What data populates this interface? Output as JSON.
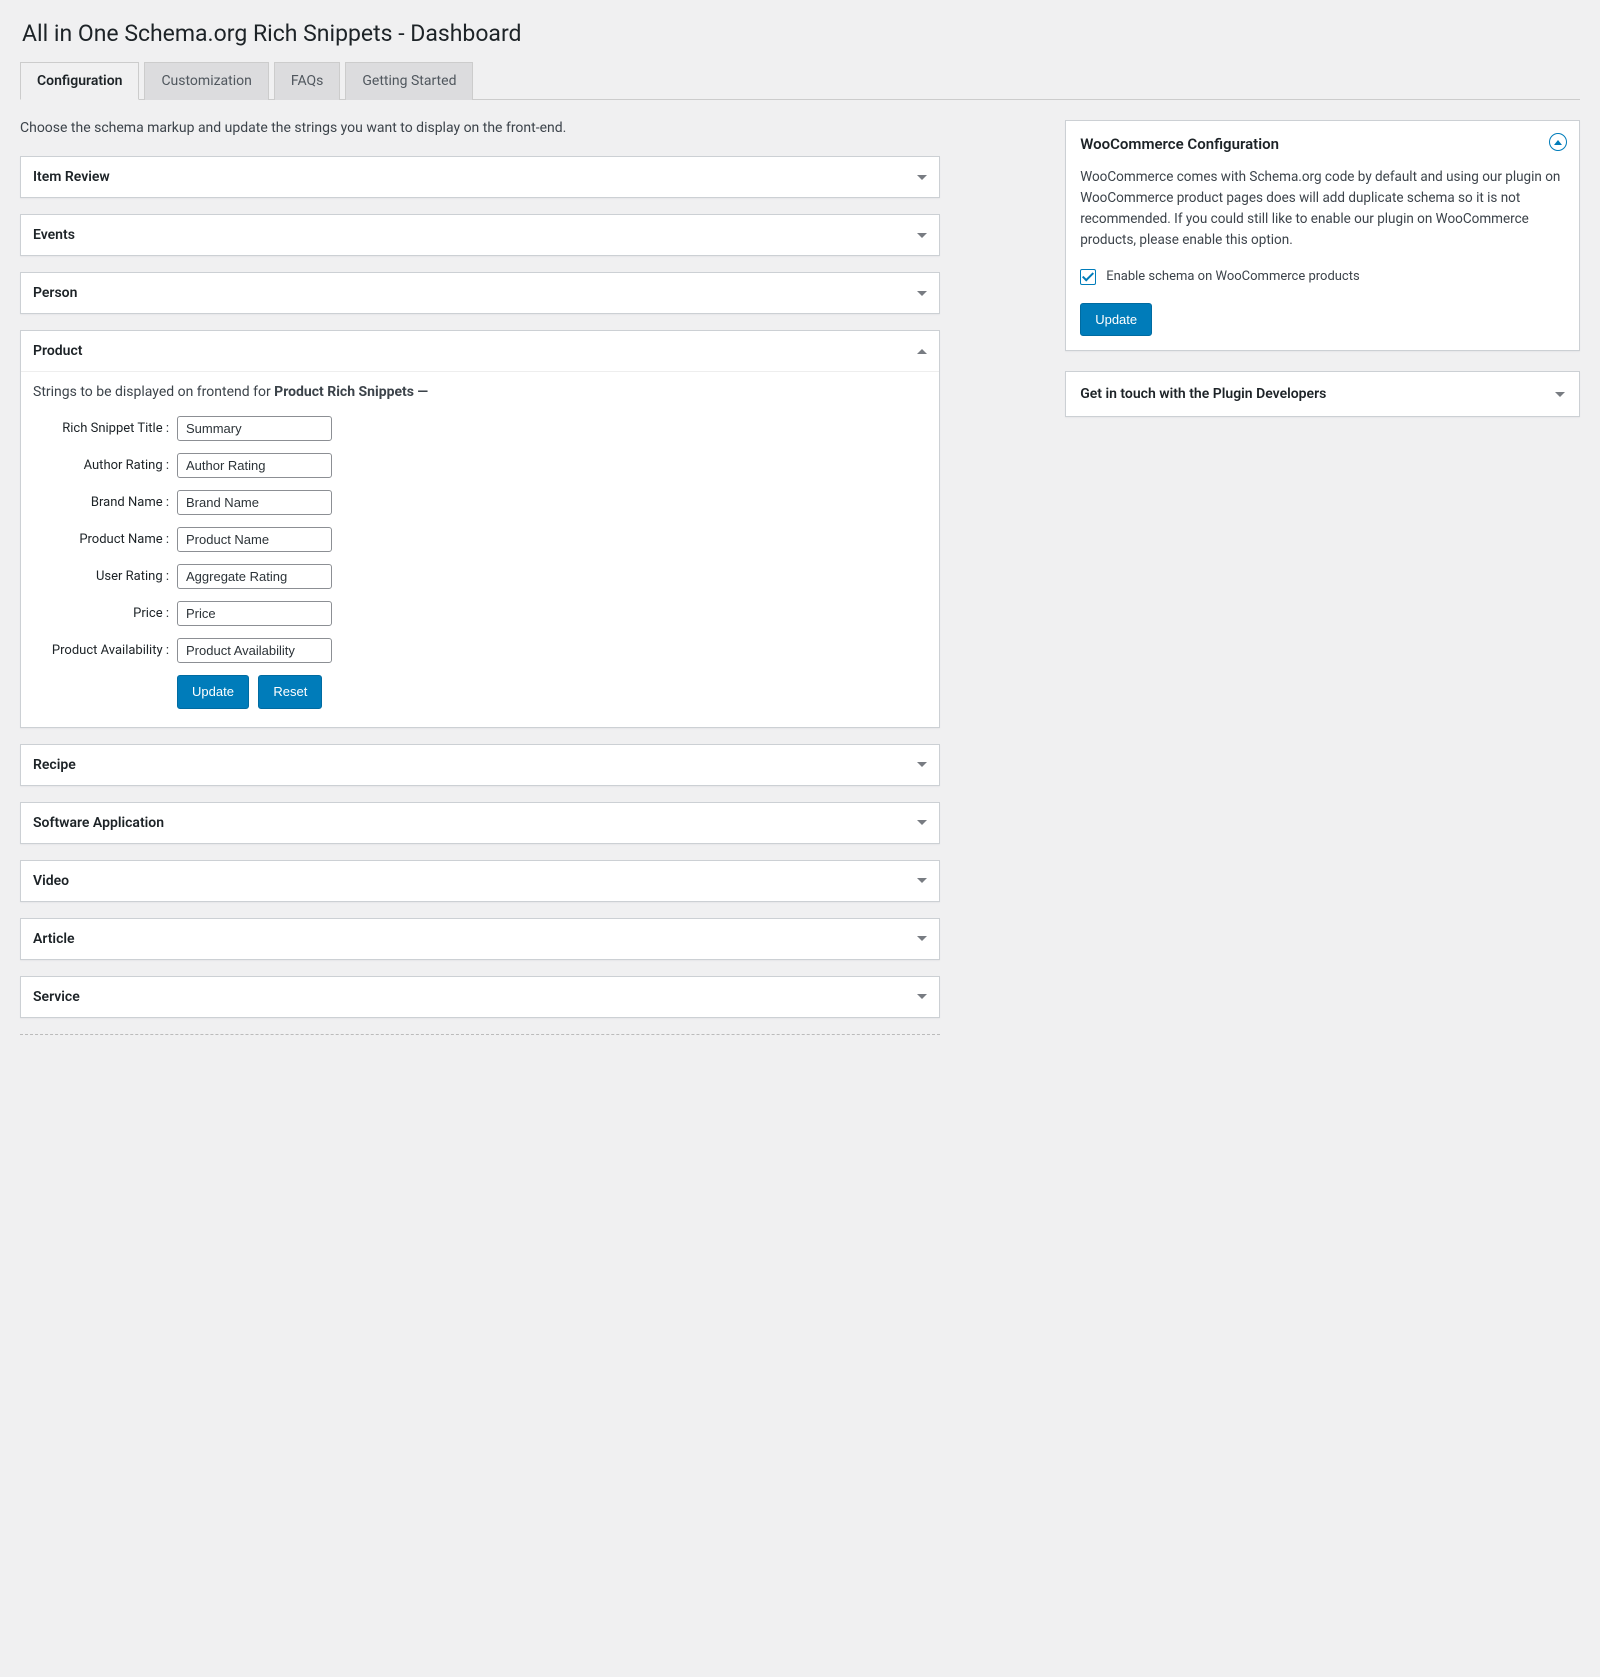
{
  "page_title": "All in One Schema.org Rich Snippets - Dashboard",
  "tabs": {
    "configuration": "Configuration",
    "customization": "Customization",
    "faqs": "FAQs",
    "getting_started": "Getting Started"
  },
  "intro": "Choose the schema markup and update the strings you want to display on the front-end.",
  "accordion": {
    "item_review": "Item Review",
    "events": "Events",
    "person": "Person",
    "product": "Product",
    "recipe": "Recipe",
    "software_application": "Software Application",
    "video": "Video",
    "article": "Article",
    "service": "Service"
  },
  "product_panel": {
    "description_prefix": "Strings to be displayed on frontend for ",
    "description_strong": "Product Rich Snippets —",
    "fields": {
      "rich_snippet_title": {
        "label": "Rich Snippet Title :",
        "value": "Summary"
      },
      "author_rating": {
        "label": "Author Rating :",
        "value": "Author Rating"
      },
      "brand_name": {
        "label": "Brand Name :",
        "value": "Brand Name"
      },
      "product_name": {
        "label": "Product Name :",
        "value": "Product Name"
      },
      "user_rating": {
        "label": "User Rating :",
        "value": "Aggregate Rating"
      },
      "price": {
        "label": "Price :",
        "value": "Price"
      },
      "product_availability": {
        "label": "Product Availability :",
        "value": "Product Availability"
      }
    },
    "update_btn": "Update",
    "reset_btn": "Reset"
  },
  "sidebar": {
    "woo": {
      "title": "WooCommerce Configuration",
      "body": "WooCommerce comes with Schema.org code by default and using our plugin on WooCommerce product pages does will add duplicate schema so it is not recommended. If you could still like to enable our plugin on WooCommerce products, please enable this option.",
      "checkbox_label": "Enable schema on WooCommerce products",
      "update_btn": "Update"
    },
    "contact": {
      "title": "Get in touch with the Plugin Developers"
    }
  }
}
